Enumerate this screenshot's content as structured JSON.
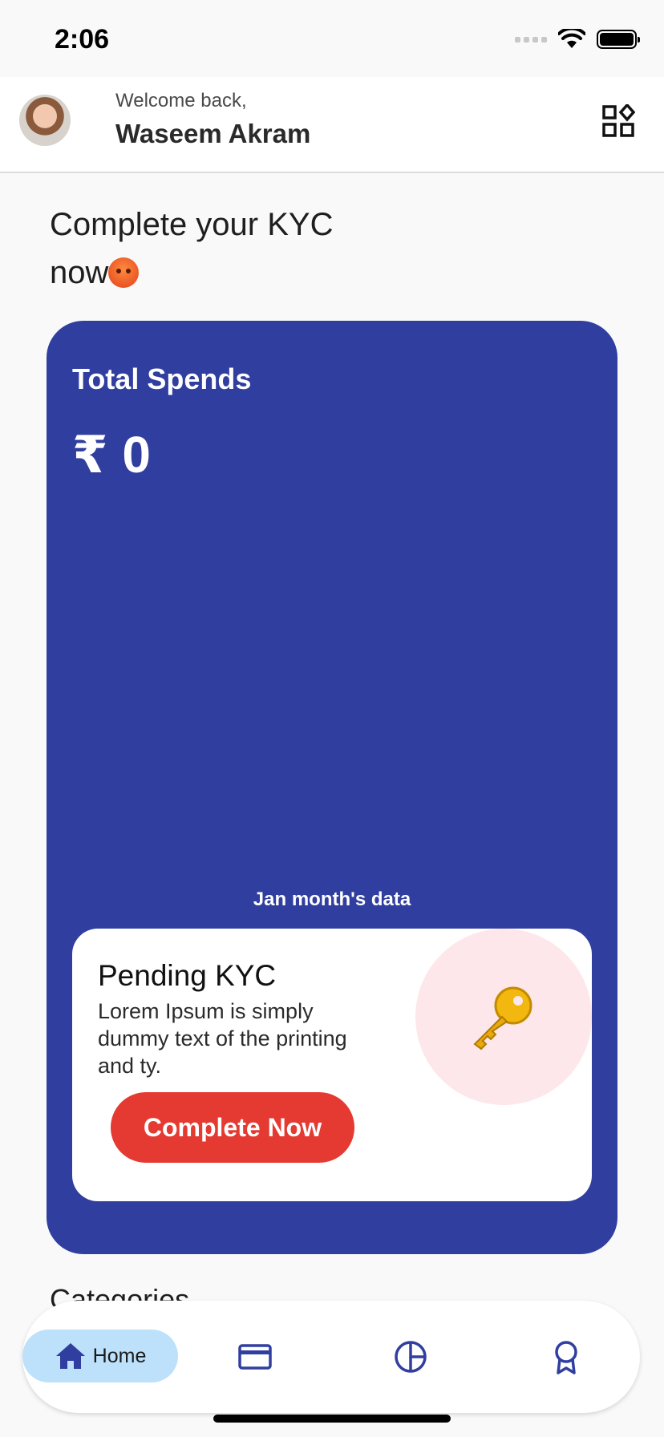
{
  "status_bar": {
    "time": "2:06"
  },
  "header": {
    "welcome_text": "Welcome back,",
    "user_name": "Waseem Akram",
    "apps_icon": "apps-grid-icon"
  },
  "kyc_prompt": {
    "title": "Complete your KYC now",
    "line1": "Complete your KYC",
    "line2": "now"
  },
  "spend_card": {
    "label": "Total Spends",
    "amount": "₹ 0",
    "month_label": "Jan month's data",
    "background_color": "#303e9f"
  },
  "pending_kyc": {
    "title": "Pending KYC",
    "description": "Lorem Ipsum is simply dummy text of the printing and ty.",
    "button_label": "Complete Now",
    "button_color": "#e53a32",
    "icon": "key-icon"
  },
  "categories": {
    "title": "Categories"
  },
  "bottom_nav": {
    "items": [
      {
        "label": "Home",
        "icon": "home-icon",
        "active": true
      },
      {
        "label": "",
        "icon": "card-icon"
      },
      {
        "label": "",
        "icon": "pie-chart-icon"
      },
      {
        "label": "",
        "icon": "award-icon"
      }
    ],
    "active_color": "#bde0fb",
    "icon_color": "#303e9f"
  }
}
